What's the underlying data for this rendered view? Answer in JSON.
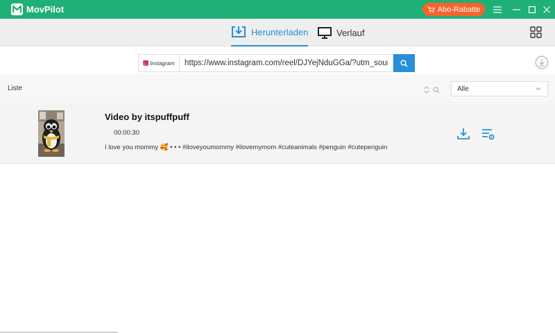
{
  "app": {
    "title": "MovPilot",
    "promo_label": "Abo-Rabatte"
  },
  "tabs": [
    {
      "label": "Herunterladen",
      "active": true
    },
    {
      "label": "Verlauf",
      "active": false
    }
  ],
  "source": {
    "site_label": "Instagram"
  },
  "search": {
    "url_value": "https://www.instagram.com/reel/DJYejNduGGa/?utm_source=ig_web_copy_link"
  },
  "list": {
    "label": "Liste",
    "filter_value": "Alle"
  },
  "videos": [
    {
      "title": "Video by itspuffpuff",
      "duration": "00:00:30",
      "description": "I love you mommy 🥰 • • • #iloveyoumommy #ilovemymom #cuteanimals #penguin #cutepenguin"
    }
  ],
  "colors": {
    "titlebar": "#1fb076",
    "accent": "#2a8ed8",
    "promo": "#f7632c"
  },
  "icons": [
    "logo-icon",
    "cart-icon",
    "menu-icon",
    "minimize-icon",
    "maximize-icon",
    "close-icon",
    "download-tab-icon",
    "monitor-icon",
    "grid-icon",
    "instagram-icon",
    "search-icon",
    "download-circle-icon",
    "sort-icon",
    "chevron-down-icon",
    "download-icon",
    "settings-list-icon"
  ]
}
